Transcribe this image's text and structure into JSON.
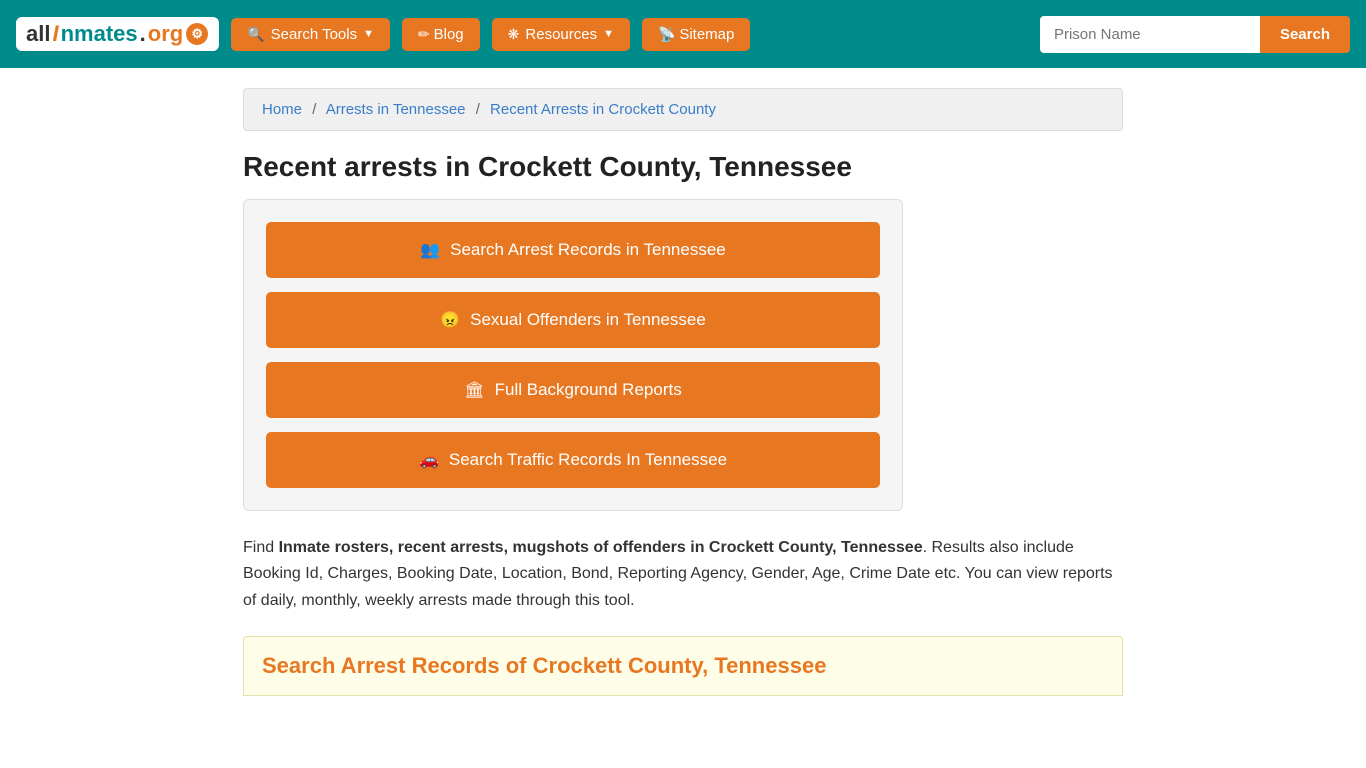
{
  "brand": {
    "name_all": "all",
    "name_inmates": "Inmates",
    "name_org": ".org",
    "logo_text": "allInmates.org"
  },
  "navbar": {
    "search_tools_label": "Search Tools",
    "blog_label": "Blog",
    "resources_label": "Resources",
    "sitemap_label": "Sitemap",
    "search_placeholder": "Prison Name",
    "search_button_label": "Search"
  },
  "breadcrumb": {
    "home": "Home",
    "arrests_tennessee": "Arrests in Tennessee",
    "current": "Recent Arrests in Crockett County"
  },
  "page": {
    "title": "Recent arrests in Crockett County, Tennessee"
  },
  "action_buttons": [
    {
      "id": "arrest-records",
      "label": "Search Arrest Records in Tennessee",
      "icon": "users"
    },
    {
      "id": "sexual-offenders",
      "label": "Sexual Offenders in Tennessee",
      "icon": "offender"
    },
    {
      "id": "background-reports",
      "label": "Full Background Reports",
      "icon": "building"
    },
    {
      "id": "traffic-records",
      "label": "Search Traffic Records In Tennessee",
      "icon": "car"
    }
  ],
  "description": {
    "intro": "Find ",
    "bold_text": "Inmate rosters, recent arrests, mugshots of offenders in Crockett County, Tennessee",
    "rest": ". Results also include Booking Id, Charges, Booking Date, Location, Bond, Reporting Agency, Gender, Age, Crime Date etc. You can view reports of daily, monthly, weekly arrests made through this tool."
  },
  "search_section": {
    "heading": "Search Arrest Records of Crockett County, Tennessee"
  }
}
